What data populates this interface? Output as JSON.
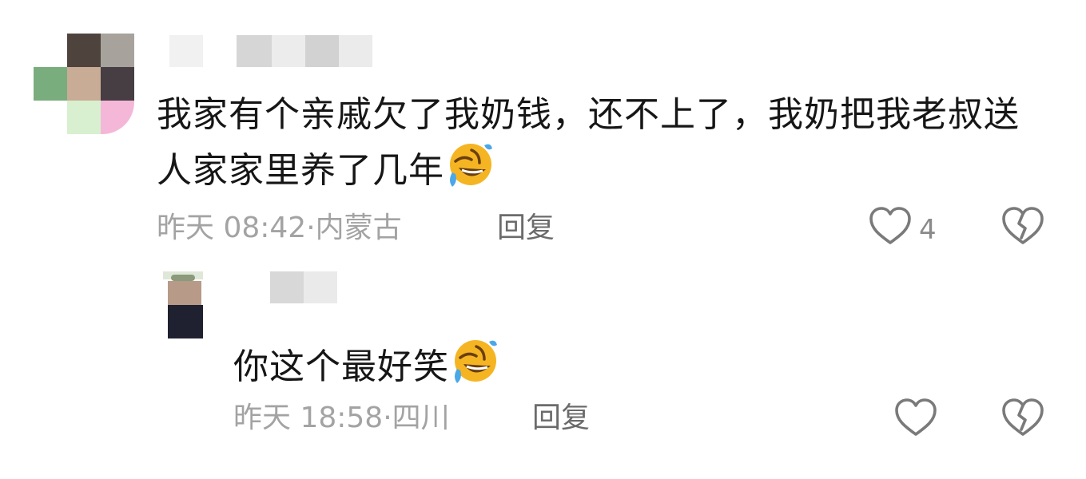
{
  "comments": [
    {
      "text": "我家有个亲戚欠了我奶钱，还不上了，我奶把我老叔送人家家里养了几年",
      "emoji_name": "rolling-on-the-floor-laughing-emoji",
      "time": "昨天 08:42",
      "location": "内蒙古",
      "reply_label": "回复",
      "like_count": "4"
    },
    {
      "text": "你这个最好笑",
      "emoji_name": "rolling-on-the-floor-laughing-emoji",
      "time": "昨天 18:58",
      "location": "四川",
      "reply_label": "回复"
    }
  ],
  "meta_separator": "·",
  "icons": {
    "like": "heart-outline-icon",
    "dislike": "broken-heart-outline-icon"
  },
  "colors": {
    "text": "#161616",
    "meta": "#a3a3a3",
    "reply": "#6b6b6b",
    "icon": "#7a7a7a",
    "emoji_face": "#f5b523"
  }
}
